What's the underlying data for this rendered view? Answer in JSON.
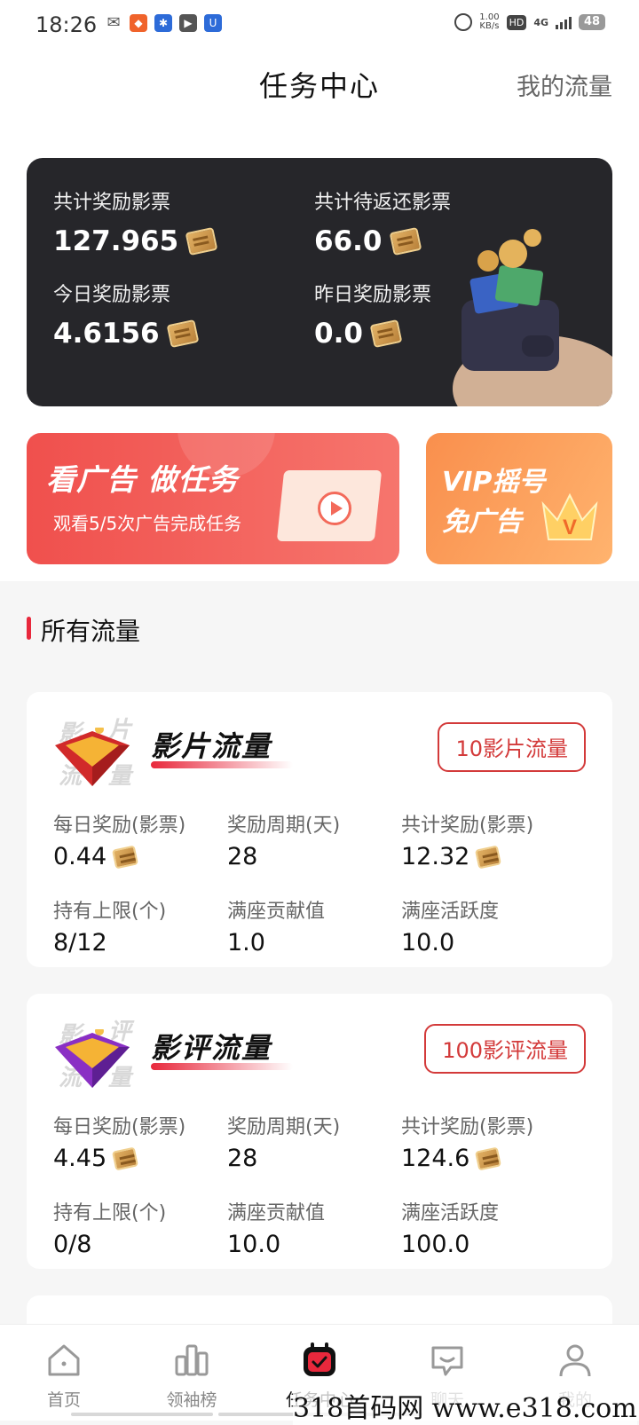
{
  "status_bar": {
    "time": "18:26",
    "speed_value": "1.00",
    "speed_unit": "KB/s",
    "hd": "HD",
    "network": "4G",
    "battery": "48"
  },
  "header": {
    "title": "任务中心",
    "right_link": "我的流量"
  },
  "stats": [
    {
      "label": "共计奖励影票",
      "value": "127.965"
    },
    {
      "label": "共计待返还影票",
      "value": "66.0"
    },
    {
      "label": "今日奖励影票",
      "value": "4.6156"
    },
    {
      "label": "昨日奖励影票",
      "value": "0.0"
    }
  ],
  "banners": {
    "ad": {
      "title": "看广告 做任务",
      "subtitle": "观看5/5次广告完成任务"
    },
    "vip": {
      "line1": "VIP摇号",
      "line2": "免广告"
    }
  },
  "section_title": "所有流量",
  "flows": [
    {
      "title": "影片流量",
      "emblem_chars": [
        "影",
        "片",
        "流",
        "量"
      ],
      "button": "10影片流量",
      "stats": [
        {
          "label": "每日奖励(影票)",
          "value": "0.44"
        },
        {
          "label": "奖励周期(天)",
          "value": "28"
        },
        {
          "label": "共计奖励(影票)",
          "value": "12.32"
        },
        {
          "label": "持有上限(个)",
          "value": "8/12"
        },
        {
          "label": "满座贡献值",
          "value": "1.0"
        },
        {
          "label": "满座活跃度",
          "value": "10.0"
        }
      ]
    },
    {
      "title": "影评流量",
      "emblem_chars": [
        "影",
        "评",
        "流",
        "量"
      ],
      "button": "100影评流量",
      "stats": [
        {
          "label": "每日奖励(影票)",
          "value": "4.45"
        },
        {
          "label": "奖励周期(天)",
          "value": "28"
        },
        {
          "label": "共计奖励(影票)",
          "value": "124.6"
        },
        {
          "label": "持有上限(个)",
          "value": "0/8"
        },
        {
          "label": "满座贡献值",
          "value": "10.0"
        },
        {
          "label": "满座活跃度",
          "value": "100.0"
        }
      ]
    }
  ],
  "bottom_nav": [
    {
      "label": "首页",
      "icon": "home-icon"
    },
    {
      "label": "领袖榜",
      "icon": "leaderboard-icon"
    },
    {
      "label": "任务中心",
      "icon": "task-calendar-icon",
      "active": true
    },
    {
      "label": "聊天",
      "icon": "chat-icon"
    },
    {
      "label": "我的",
      "icon": "profile-icon"
    }
  ],
  "watermark": "318首码网 www.e318.com",
  "colors": {
    "accent_red": "#e8283c",
    "card_dark": "#26262a",
    "banner_red": "#f0504d",
    "banner_orange": "#f98f4d"
  }
}
